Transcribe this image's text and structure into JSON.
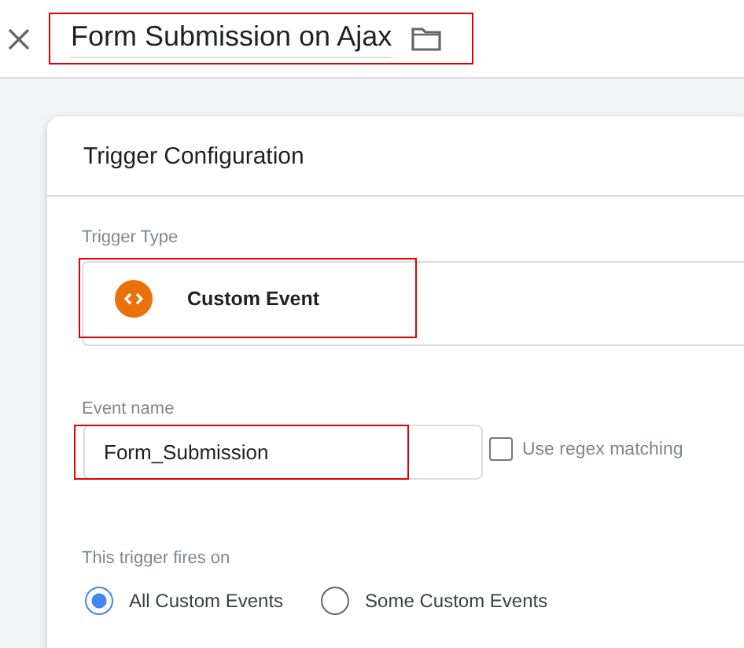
{
  "header": {
    "title": "Form Submission on Ajax",
    "highlighted": true
  },
  "card": {
    "title": "Trigger Configuration",
    "trigger_type": {
      "label": "Trigger Type",
      "value": "Custom Event",
      "highlighted": true
    },
    "event_name": {
      "label": "Event name",
      "value": "Form_Submission",
      "highlighted": true,
      "regex": {
        "label": "Use regex matching",
        "checked": false
      }
    },
    "fires_on": {
      "label": "This trigger fires on",
      "options": [
        {
          "label": "All Custom Events",
          "selected": true
        },
        {
          "label": "Some Custom Events",
          "selected": false
        }
      ]
    }
  }
}
